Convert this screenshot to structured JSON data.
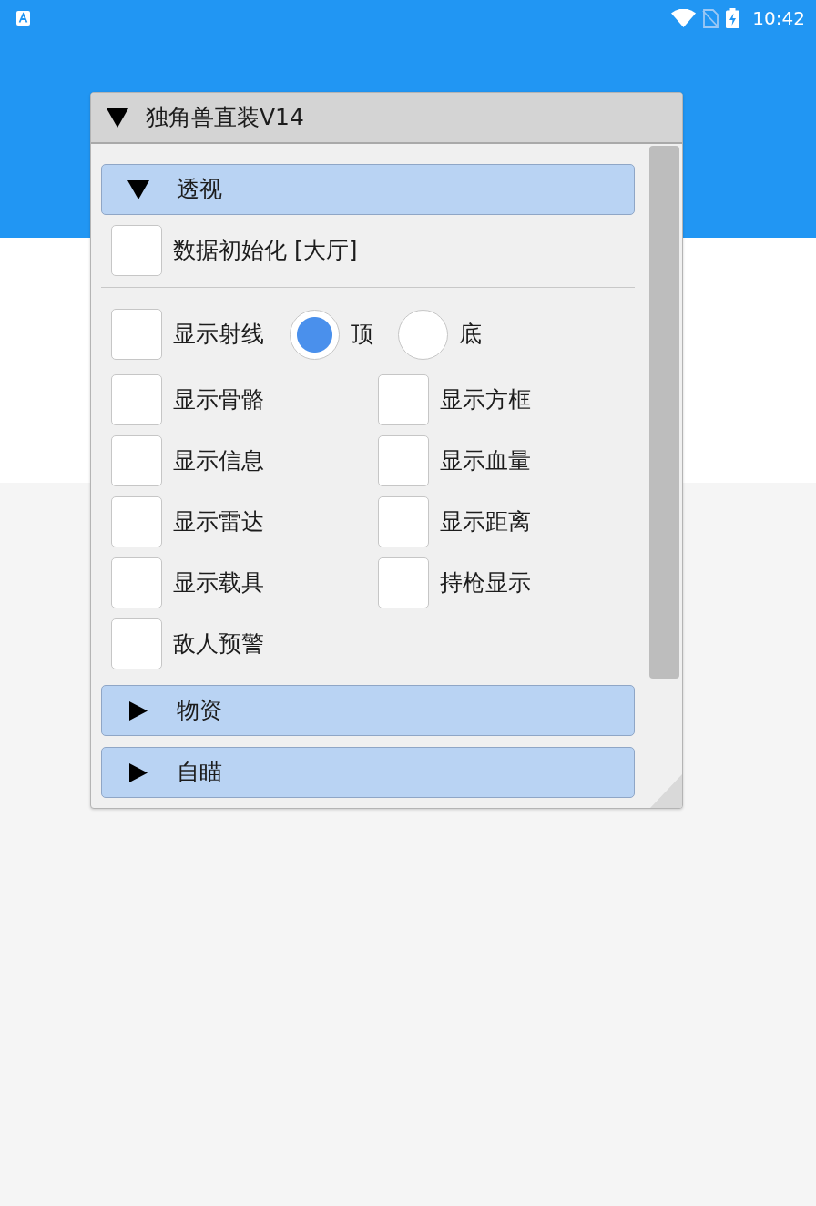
{
  "status_bar": {
    "time": "10:42"
  },
  "window": {
    "title": "独角兽直装V14",
    "expanded": true
  },
  "sections": [
    {
      "label": "透视",
      "expanded": true,
      "items": [
        {
          "kind": "checkbox",
          "label": "数据初始化 [大厅]",
          "checked": false
        },
        {
          "kind": "divider"
        },
        {
          "kind": "checkbox_radio",
          "label": "显示射线",
          "checked": false,
          "options": [
            {
              "label": "顶",
              "selected": true
            },
            {
              "label": "底",
              "selected": false
            }
          ]
        },
        {
          "kind": "grid",
          "cells": [
            {
              "label": "显示骨骼",
              "checked": false
            },
            {
              "label": "显示方框",
              "checked": false
            },
            {
              "label": "显示信息",
              "checked": false
            },
            {
              "label": "显示血量",
              "checked": false
            },
            {
              "label": "显示雷达",
              "checked": false
            },
            {
              "label": "显示距离",
              "checked": false
            },
            {
              "label": "显示载具",
              "checked": false
            },
            {
              "label": "持枪显示",
              "checked": false
            },
            {
              "label": "敌人预警",
              "checked": false
            }
          ]
        }
      ]
    },
    {
      "label": "物资",
      "expanded": false
    },
    {
      "label": "自瞄",
      "expanded": false
    }
  ]
}
